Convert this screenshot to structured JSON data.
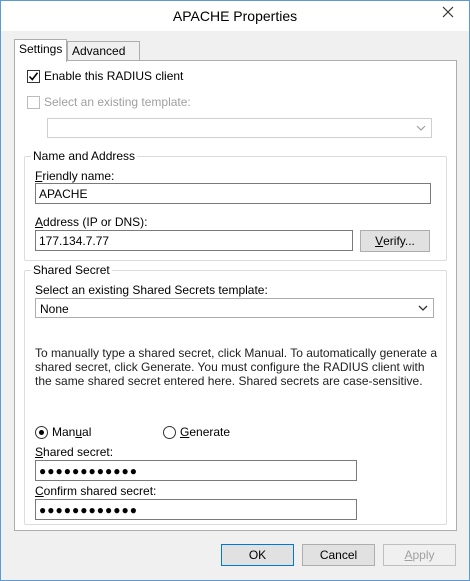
{
  "window": {
    "title": "APACHE Properties"
  },
  "tabs": [
    {
      "label": "Settings"
    },
    {
      "label": "Advanced"
    }
  ],
  "enable_client": {
    "label": "Enable this RADIUS client",
    "checked": true
  },
  "template": {
    "label": "Select an existing template:",
    "checked": false,
    "value": ""
  },
  "name_address": {
    "title": "Name and Address",
    "friendly_label": "Friendly name:",
    "friendly_value": "APACHE",
    "address_label": "Address (IP or DNS):",
    "address_value": "177.134.7.77",
    "verify_label": "Verify..."
  },
  "shared_secret": {
    "title": "Shared Secret",
    "template_label": "Select an existing Shared Secrets template:",
    "template_value": "None",
    "description": "To manually type a shared secret, click Manual. To automatically generate a shared secret, click Generate. You must configure the RADIUS client with the same shared secret entered here. Shared secrets are case-sensitive.",
    "manual_label": "Manual",
    "generate_label": "Generate",
    "secret_label": "Shared secret:",
    "secret_value": "●●●●●●●●●●●●",
    "confirm_label": "Confirm shared secret:",
    "confirm_value": "●●●●●●●●●●●●"
  },
  "footer": {
    "ok": "OK",
    "cancel": "Cancel",
    "apply": "Apply"
  },
  "colors": {
    "accent": "#0078d7",
    "window_border": "#5a9bd5"
  }
}
